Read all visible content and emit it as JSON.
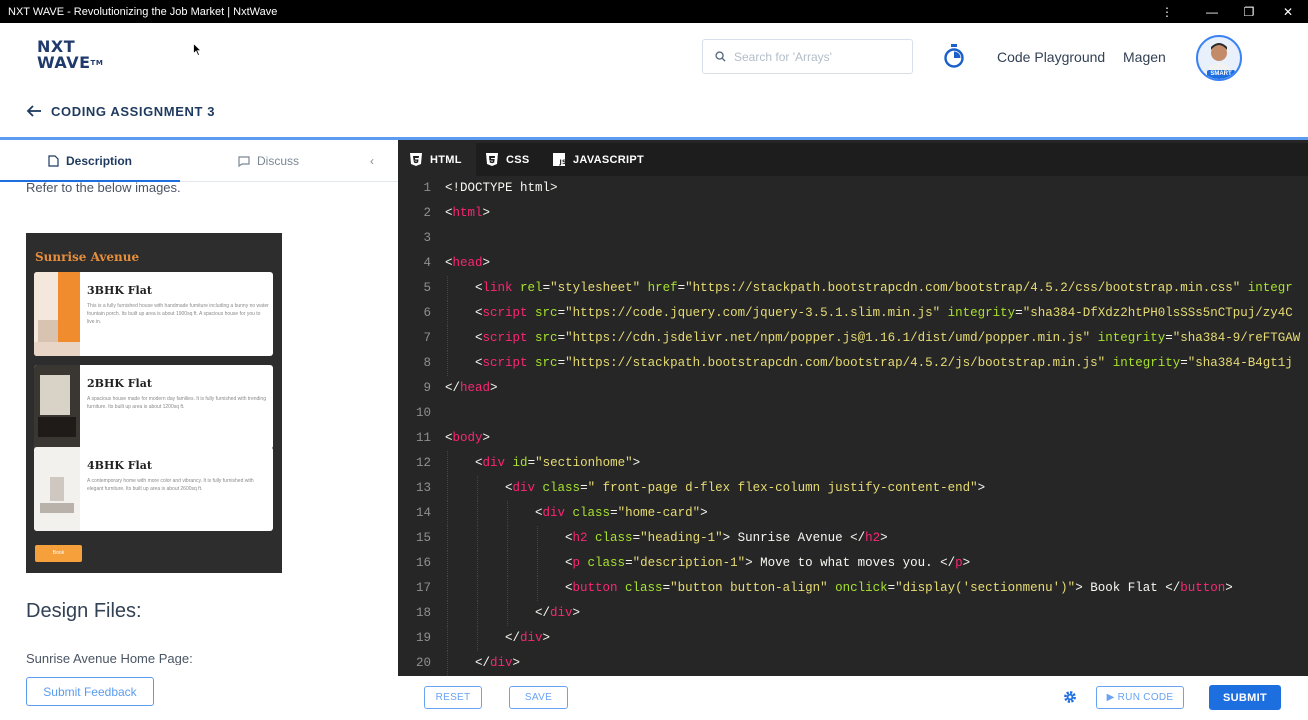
{
  "window": {
    "title": "NXT WAVE - Revolutionizing the Job Market | NxtWave",
    "controls": [
      "⋮",
      "—",
      "❐",
      "✕"
    ]
  },
  "header": {
    "logo_line1": "NXT",
    "logo_line2": "WAVE",
    "logo_tm": "TM",
    "search_placeholder": "Search for 'Arrays'",
    "nav": [
      "Code Playground",
      "Magen"
    ],
    "avatar_badge": "SMART"
  },
  "assignment": {
    "title": "CODING ASSIGNMENT 3"
  },
  "left_panel": {
    "tabs": [
      {
        "label": "Description",
        "icon": "document-icon"
      },
      {
        "label": "Discuss",
        "icon": "chat-icon"
      }
    ],
    "collapse": "‹",
    "intro": "Refer to the below images.",
    "preview": {
      "title": "Sunrise Avenue",
      "cards": [
        {
          "name": "3BHK Flat",
          "desc": "This is a fully furnished house with handmade furniture including a bunny no water fountain porch. Its built up area is about 1900sq ft. A spacious house for you to live in."
        },
        {
          "name": "2BHK Flat",
          "desc": "A spacious house made for modern day families. It is fully furnished with trending furniture. Its built up area is about 1200sq ft."
        },
        {
          "name": "4BHK Flat",
          "desc": "A contemporary home with more color and vibrancy. It is fully furnished with elegant furniture. Its built up area is about 2600sq ft."
        }
      ],
      "button": "Book"
    },
    "design_files": "Design Files:",
    "home_page_label": "Sunrise Avenue Home Page:",
    "feedback_button": "Submit Feedback"
  },
  "editor": {
    "tabs": [
      {
        "label": "HTML",
        "icon": "html5-icon"
      },
      {
        "label": "CSS",
        "icon": "css3-icon"
      },
      {
        "label": "JAVASCRIPT",
        "icon": "javascript-icon"
      }
    ],
    "lines": [
      {
        "n": "1",
        "indent": 0,
        "tokens": [
          [
            "txt",
            "<!DOCTYPE html>"
          ]
        ]
      },
      {
        "n": "2",
        "indent": 0,
        "tokens": [
          [
            "txt",
            "<"
          ],
          [
            "tag",
            "html"
          ],
          [
            "txt",
            ">"
          ]
        ]
      },
      {
        "n": "3",
        "indent": 0,
        "tokens": []
      },
      {
        "n": "4",
        "indent": 0,
        "tokens": [
          [
            "txt",
            "<"
          ],
          [
            "tag",
            "head"
          ],
          [
            "txt",
            ">"
          ]
        ]
      },
      {
        "n": "5",
        "indent": 1,
        "tokens": [
          [
            "txt",
            "<"
          ],
          [
            "tag",
            "link"
          ],
          [
            "txt",
            " "
          ],
          [
            "attr",
            "rel"
          ],
          [
            "txt",
            "="
          ],
          [
            "str",
            "\"stylesheet\""
          ],
          [
            "txt",
            " "
          ],
          [
            "attr",
            "href"
          ],
          [
            "txt",
            "="
          ],
          [
            "str",
            "\"https://stackpath.bootstrapcdn.com/bootstrap/4.5.2/css/bootstrap.min.css\""
          ],
          [
            "txt",
            " "
          ],
          [
            "attr",
            "integr"
          ]
        ]
      },
      {
        "n": "6",
        "indent": 1,
        "tokens": [
          [
            "txt",
            "<"
          ],
          [
            "tag",
            "script"
          ],
          [
            "txt",
            " "
          ],
          [
            "attr",
            "src"
          ],
          [
            "txt",
            "="
          ],
          [
            "str",
            "\"https://code.jquery.com/jquery-3.5.1.slim.min.js\""
          ],
          [
            "txt",
            " "
          ],
          [
            "attr",
            "integrity"
          ],
          [
            "txt",
            "="
          ],
          [
            "str",
            "\"sha384-DfXdz2htPH0lsSSs5nCTpuj/zy4C"
          ]
        ]
      },
      {
        "n": "7",
        "indent": 1,
        "tokens": [
          [
            "txt",
            "<"
          ],
          [
            "tag",
            "script"
          ],
          [
            "txt",
            " "
          ],
          [
            "attr",
            "src"
          ],
          [
            "txt",
            "="
          ],
          [
            "str",
            "\"https://cdn.jsdelivr.net/npm/popper.js@1.16.1/dist/umd/popper.min.js\""
          ],
          [
            "txt",
            " "
          ],
          [
            "attr",
            "integrity"
          ],
          [
            "txt",
            "="
          ],
          [
            "str",
            "\"sha384-9/reFTGAW"
          ]
        ]
      },
      {
        "n": "8",
        "indent": 1,
        "tokens": [
          [
            "txt",
            "<"
          ],
          [
            "tag",
            "script"
          ],
          [
            "txt",
            " "
          ],
          [
            "attr",
            "src"
          ],
          [
            "txt",
            "="
          ],
          [
            "str",
            "\"https://stackpath.bootstrapcdn.com/bootstrap/4.5.2/js/bootstrap.min.js\""
          ],
          [
            "txt",
            " "
          ],
          [
            "attr",
            "integrity"
          ],
          [
            "txt",
            "="
          ],
          [
            "str",
            "\"sha384-B4gt1j"
          ]
        ]
      },
      {
        "n": "9",
        "indent": 0,
        "tokens": [
          [
            "txt",
            "</"
          ],
          [
            "tag",
            "head"
          ],
          [
            "txt",
            ">"
          ]
        ]
      },
      {
        "n": "10",
        "indent": 0,
        "tokens": []
      },
      {
        "n": "11",
        "indent": 0,
        "tokens": [
          [
            "txt",
            "<"
          ],
          [
            "tag",
            "body"
          ],
          [
            "txt",
            ">"
          ]
        ]
      },
      {
        "n": "12",
        "indent": 1,
        "tokens": [
          [
            "txt",
            "<"
          ],
          [
            "tag",
            "div"
          ],
          [
            "txt",
            " "
          ],
          [
            "attr",
            "id"
          ],
          [
            "txt",
            "="
          ],
          [
            "str",
            "\"sectionhome\""
          ],
          [
            "txt",
            ">"
          ]
        ]
      },
      {
        "n": "13",
        "indent": 2,
        "tokens": [
          [
            "txt",
            "<"
          ],
          [
            "tag",
            "div"
          ],
          [
            "txt",
            " "
          ],
          [
            "attr",
            "class"
          ],
          [
            "txt",
            "="
          ],
          [
            "str",
            "\" front-page d-flex flex-column justify-content-end\""
          ],
          [
            "txt",
            ">"
          ]
        ]
      },
      {
        "n": "14",
        "indent": 3,
        "tokens": [
          [
            "txt",
            "<"
          ],
          [
            "tag",
            "div"
          ],
          [
            "txt",
            " "
          ],
          [
            "attr",
            "class"
          ],
          [
            "txt",
            "="
          ],
          [
            "str",
            "\"home-card\""
          ],
          [
            "txt",
            ">"
          ]
        ]
      },
      {
        "n": "15",
        "indent": 4,
        "tokens": [
          [
            "txt",
            "<"
          ],
          [
            "tag",
            "h2"
          ],
          [
            "txt",
            " "
          ],
          [
            "attr",
            "class"
          ],
          [
            "txt",
            "="
          ],
          [
            "str",
            "\"heading-1\""
          ],
          [
            "txt",
            "> Sunrise Avenue </"
          ],
          [
            "tag",
            "h2"
          ],
          [
            "txt",
            ">"
          ]
        ]
      },
      {
        "n": "16",
        "indent": 4,
        "tokens": [
          [
            "txt",
            "<"
          ],
          [
            "tag",
            "p"
          ],
          [
            "txt",
            " "
          ],
          [
            "attr",
            "class"
          ],
          [
            "txt",
            "="
          ],
          [
            "str",
            "\"description-1\""
          ],
          [
            "txt",
            "> Move to what moves you. </"
          ],
          [
            "tag",
            "p"
          ],
          [
            "txt",
            ">"
          ]
        ]
      },
      {
        "n": "17",
        "indent": 4,
        "tokens": [
          [
            "txt",
            "<"
          ],
          [
            "tag",
            "button"
          ],
          [
            "txt",
            " "
          ],
          [
            "attr",
            "class"
          ],
          [
            "txt",
            "="
          ],
          [
            "str",
            "\"button button-align\""
          ],
          [
            "txt",
            " "
          ],
          [
            "attr",
            "onclick"
          ],
          [
            "txt",
            "="
          ],
          [
            "str",
            "\"display('sectionmenu')\""
          ],
          [
            "txt",
            "> Book Flat </"
          ],
          [
            "tag",
            "button"
          ],
          [
            "txt",
            ">"
          ]
        ]
      },
      {
        "n": "18",
        "indent": 3,
        "tokens": [
          [
            "txt",
            "</"
          ],
          [
            "tag",
            "div"
          ],
          [
            "txt",
            ">"
          ]
        ]
      },
      {
        "n": "19",
        "indent": 2,
        "tokens": [
          [
            "txt",
            "</"
          ],
          [
            "tag",
            "div"
          ],
          [
            "txt",
            ">"
          ]
        ]
      },
      {
        "n": "20",
        "indent": 1,
        "tokens": [
          [
            "txt",
            "</"
          ],
          [
            "tag",
            "div"
          ],
          [
            "txt",
            ">"
          ]
        ]
      }
    ]
  },
  "bottom_bar": {
    "reset": "RESET",
    "save": "SAVE",
    "run_code": "▶ RUN CODE",
    "submit": "SUBMIT"
  },
  "colors": {
    "accent": "#1d6fe0",
    "editor_bg": "#262626",
    "tag": "#f92672",
    "attr": "#a6e22e",
    "string": "#e6db74"
  }
}
